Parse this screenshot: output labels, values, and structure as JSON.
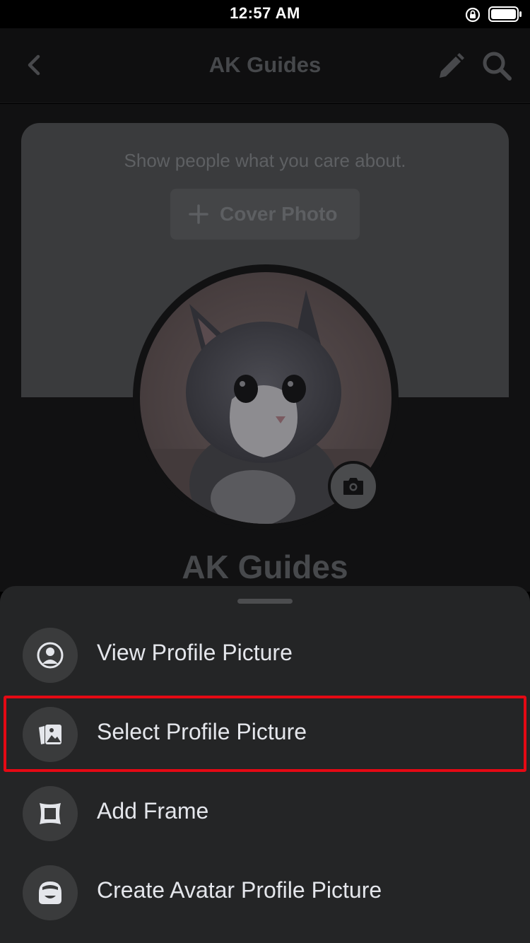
{
  "status_bar": {
    "time": "12:57 AM"
  },
  "header": {
    "title": "AK Guides"
  },
  "cover": {
    "prompt": "Show people what you care about.",
    "button_label": "Cover Photo"
  },
  "profile": {
    "name": "AK Guides"
  },
  "menu": {
    "items": [
      {
        "label": "View Profile Picture",
        "icon": "person-circle-icon"
      },
      {
        "label": "Select Profile Picture",
        "icon": "photo-gallery-icon",
        "highlighted": true
      },
      {
        "label": "Add Frame",
        "icon": "frame-icon"
      },
      {
        "label": "Create Avatar Profile Picture",
        "icon": "avatar-face-icon"
      }
    ]
  },
  "colors": {
    "sheet_bg": "#242526",
    "highlight_border": "#e50914",
    "text_primary": "#e4e6eb"
  }
}
